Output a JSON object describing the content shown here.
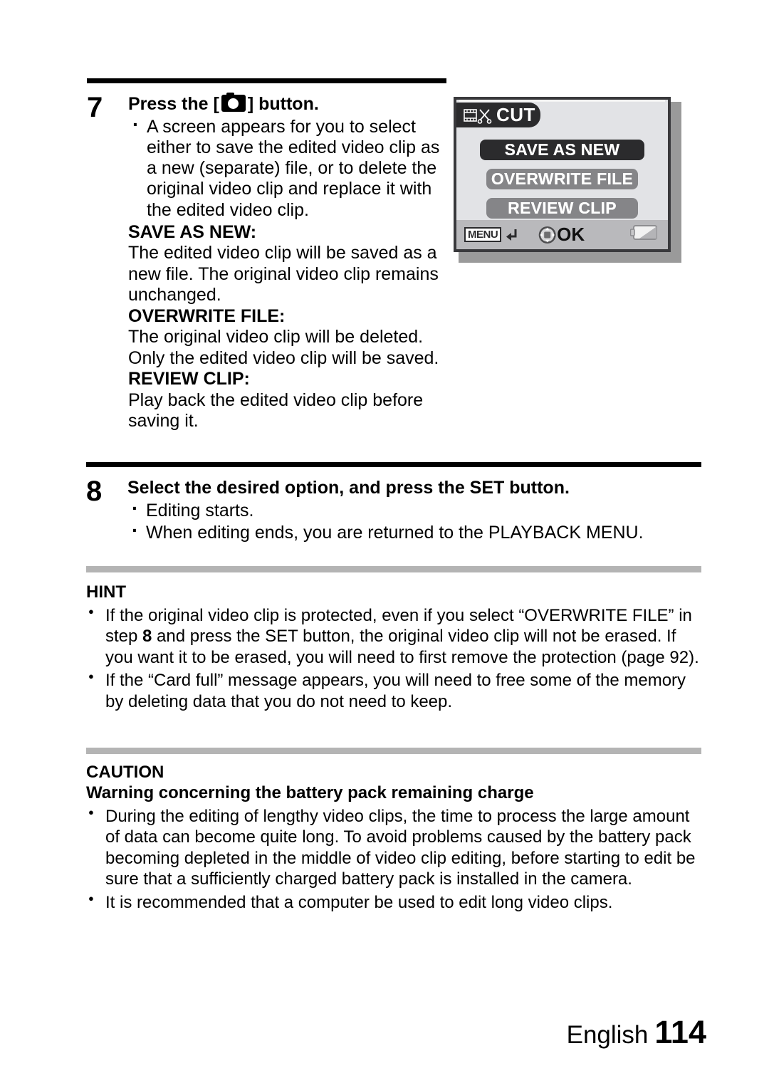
{
  "steps": [
    {
      "number": "7",
      "title_before": "Press the [",
      "title_icon": "camera-shutter-icon",
      "title_after": "] button.",
      "bullets": [
        "A screen appears for you to select either to save the edited video clip as a new (separate) file, or to delete the original video clip and replace it with the edited video clip."
      ],
      "definitions": [
        {
          "term": "SAVE AS NEW:",
          "desc": "The edited video clip will be saved as a new file. The original video clip remains unchanged."
        },
        {
          "term": "OVERWRITE FILE:",
          "desc": "The original video clip will be deleted. Only the edited video clip will be saved."
        },
        {
          "term": "REVIEW CLIP:",
          "desc": "Play back the edited video clip before saving it."
        }
      ]
    },
    {
      "number": "8",
      "title": "Select the desired option, and press the SET button.",
      "bullets": [
        "Editing starts.",
        "When editing ends, you are returned to the PLAYBACK MENU."
      ]
    }
  ],
  "lcd": {
    "title": "CUT",
    "title_icon": "film-strip-scissors-icon",
    "options": [
      {
        "label": "SAVE AS NEW",
        "selected": true
      },
      {
        "label": "OVERWRITE FILE",
        "selected": false
      },
      {
        "label": "REVIEW CLIP",
        "selected": false
      }
    ],
    "status": {
      "menu_label": "MENU",
      "menu_icon": "return-arrow-icon",
      "ok_label": "OK",
      "ok_icon": "dpad-icon",
      "battery_icon": "battery-half-icon"
    },
    "colors": {
      "screen_bg": "#e2e3e6",
      "frame": "#39393c",
      "selected": "#2b2b2d",
      "unselected": "#858588",
      "statusbar": "#b9b9bc"
    }
  },
  "hint": {
    "heading": "HINT",
    "items": [
      {
        "part1": "If the original video clip is protected, even if you select “OVERWRITE FILE” in step ",
        "bold": "8",
        "part2": " and press the SET button, the original video clip will not be erased. If you want it to be erased, you will need to first remove the protection (page 92)."
      },
      {
        "part1": "If the “Card full” message appears, you will need to free some of the memory by deleting data that you do not need to keep.",
        "bold": "",
        "part2": ""
      }
    ]
  },
  "caution": {
    "heading": "CAUTION",
    "subheading": "Warning concerning the battery pack remaining charge",
    "items": [
      "During the editing of lengthy video clips, the time to process the large amount of data can become quite long. To avoid problems caused by the battery pack becoming depleted in the middle of video clip editing, before starting to edit be sure that a sufficiently charged battery pack is installed in the camera.",
      "It is recommended that a computer be used to edit long video clips."
    ]
  },
  "footer": {
    "language": "English",
    "page": "114"
  }
}
